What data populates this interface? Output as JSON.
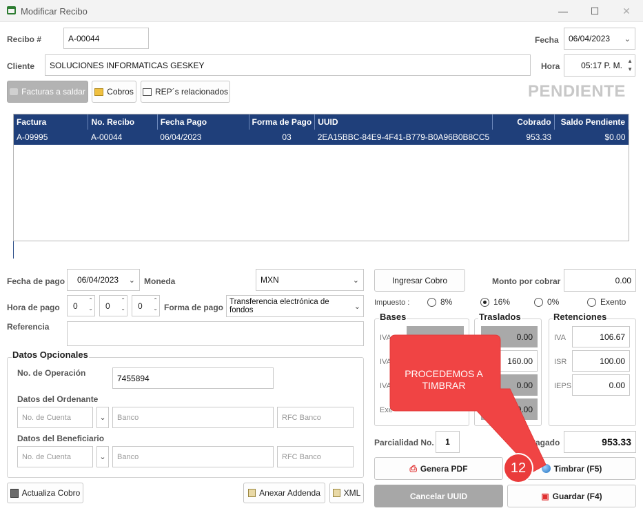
{
  "window": {
    "title": "Modificar Recibo"
  },
  "header": {
    "recibo_label": "Recibo #",
    "recibo_value": "A-00044",
    "fecha_label": "Fecha",
    "fecha_value": "06/04/2023",
    "cliente_label": "Cliente",
    "cliente_value": "SOLUCIONES INFORMATICAS GESKEY",
    "hora_label": "Hora",
    "hora_value": "05:17 P. M."
  },
  "tabs": {
    "facturas": "Facturas a saldar",
    "cobros": "Cobros",
    "rep": "REP´s relacionados"
  },
  "status": "PENDIENTE",
  "grid": {
    "columns": [
      "Factura",
      "No. Recibo",
      "Fecha Pago",
      "Forma de Pago",
      "UUID",
      "Cobrado",
      "Saldo Pendiente"
    ],
    "rows": [
      [
        "A-09995",
        "A-00044",
        "06/04/2023",
        "03",
        "2EA15BBC-84E9-4F41-B779-B0A96B0B8CC5",
        "953.33",
        "$0.00"
      ]
    ]
  },
  "pago": {
    "fecha_label": "Fecha de pago",
    "fecha_value": "06/04/2023",
    "moneda_label": "Moneda",
    "moneda_value": "MXN",
    "hora_label": "Hora de pago",
    "h": "0",
    "m": "0",
    "s": "0",
    "forma_label": "Forma de pago",
    "forma_value": "Transferencia electrónica de fondos",
    "referencia_label": "Referencia",
    "referencia_value": ""
  },
  "opcionales": {
    "title": "Datos Opcionales",
    "operacion_label": "No. de Operación",
    "operacion_value": "7455894",
    "ordenante_label": "Datos del Ordenante",
    "beneficiario_label": "Datos del Beneficiario",
    "cuenta_ph": "No. de Cuenta",
    "banco_ph": "Banco",
    "rfc_ph": "RFC Banco"
  },
  "cobro": {
    "ingresar_btn": "Ingresar Cobro",
    "monto_label": "Monto por cobrar",
    "monto_value": "0.00",
    "impuesto_label": "Impuesto :",
    "opts": [
      "8%",
      "16%",
      "0%",
      "Exento"
    ],
    "selected": "16%"
  },
  "impuestos": {
    "bases_title": "Bases",
    "traslados_title": "Traslados",
    "retenciones_title": "Retenciones",
    "bases": [
      "IVA",
      "IVA",
      "IVA",
      "Exe"
    ],
    "traslados": [
      "0.00",
      "160.00",
      "0.00",
      "0.00"
    ],
    "ret_labels": [
      "IVA",
      "ISR",
      "IEPS"
    ],
    "ret_values": [
      "106.67",
      "100.00",
      "0.00"
    ]
  },
  "totales": {
    "parcialidad_label": "Parcialidad No.",
    "parcialidad_value": "1",
    "pagado_label": "Pagado",
    "pagado_value": "953.33"
  },
  "buttons": {
    "pdf": "Genera PDF",
    "timbrar": "Timbrar (F5)",
    "cancelar": "Cancelar UUID",
    "guardar": "Guardar (F4)",
    "actualiza": "Actualiza Cobro",
    "addenda": "Anexar Addenda",
    "xml": "XML"
  },
  "callout": {
    "text": "PROCEDEMOS A TIMBRAR",
    "step": "12"
  },
  "colors": {
    "header_blue": "#1f3f7a",
    "callout_red": "#f04444",
    "status_gray": "#c8c8c8"
  }
}
